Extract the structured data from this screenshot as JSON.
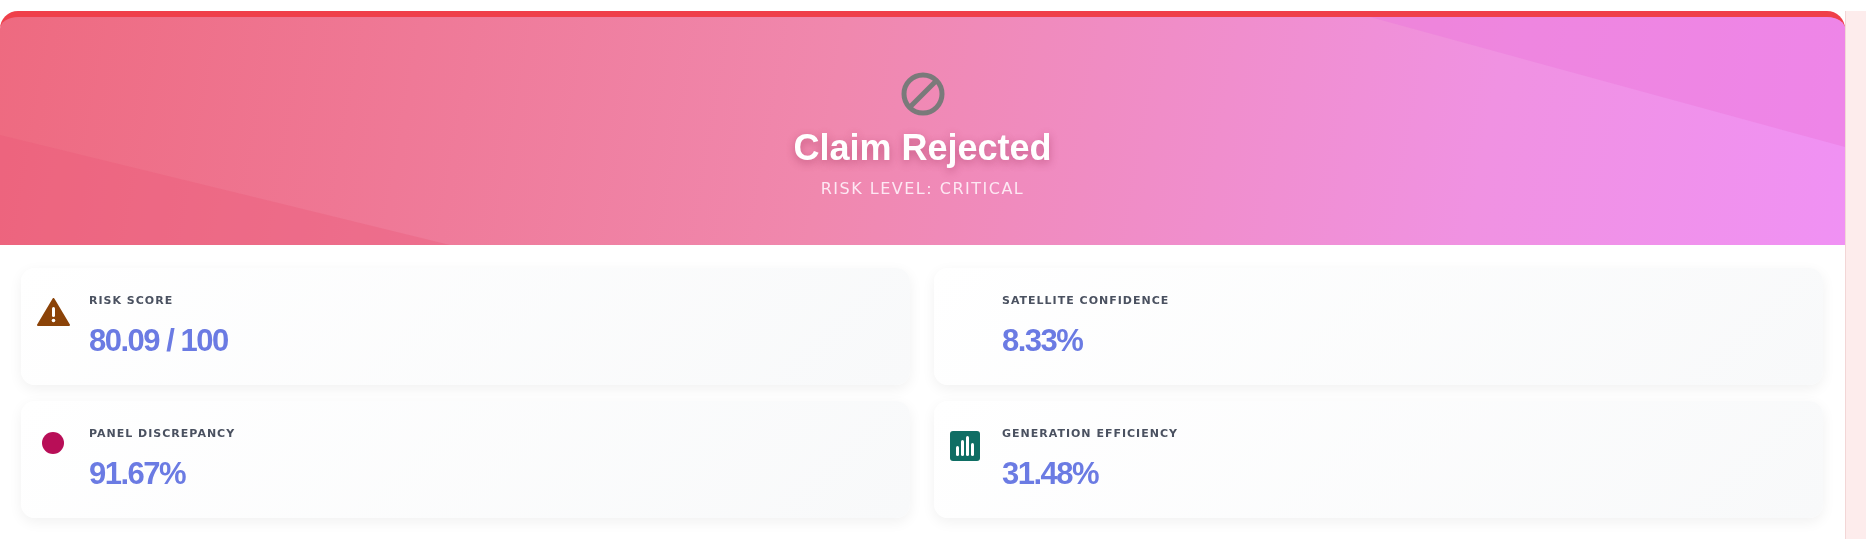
{
  "header": {
    "title": "Claim Rejected",
    "subtitle": "RISK LEVEL: CRITICAL"
  },
  "metrics": [
    {
      "kind": "warning",
      "label": "RISK SCORE",
      "value": "80.09 / 100"
    },
    {
      "kind": "plain",
      "label": "SATELLITE CONFIDENCE",
      "value": "8.33%"
    },
    {
      "kind": "dot",
      "label": "PANEL DISCREPANCY",
      "value": "91.67%"
    },
    {
      "kind": "chart",
      "label": "GENERATION EFFICIENCY",
      "value": "31.48%"
    }
  ]
}
